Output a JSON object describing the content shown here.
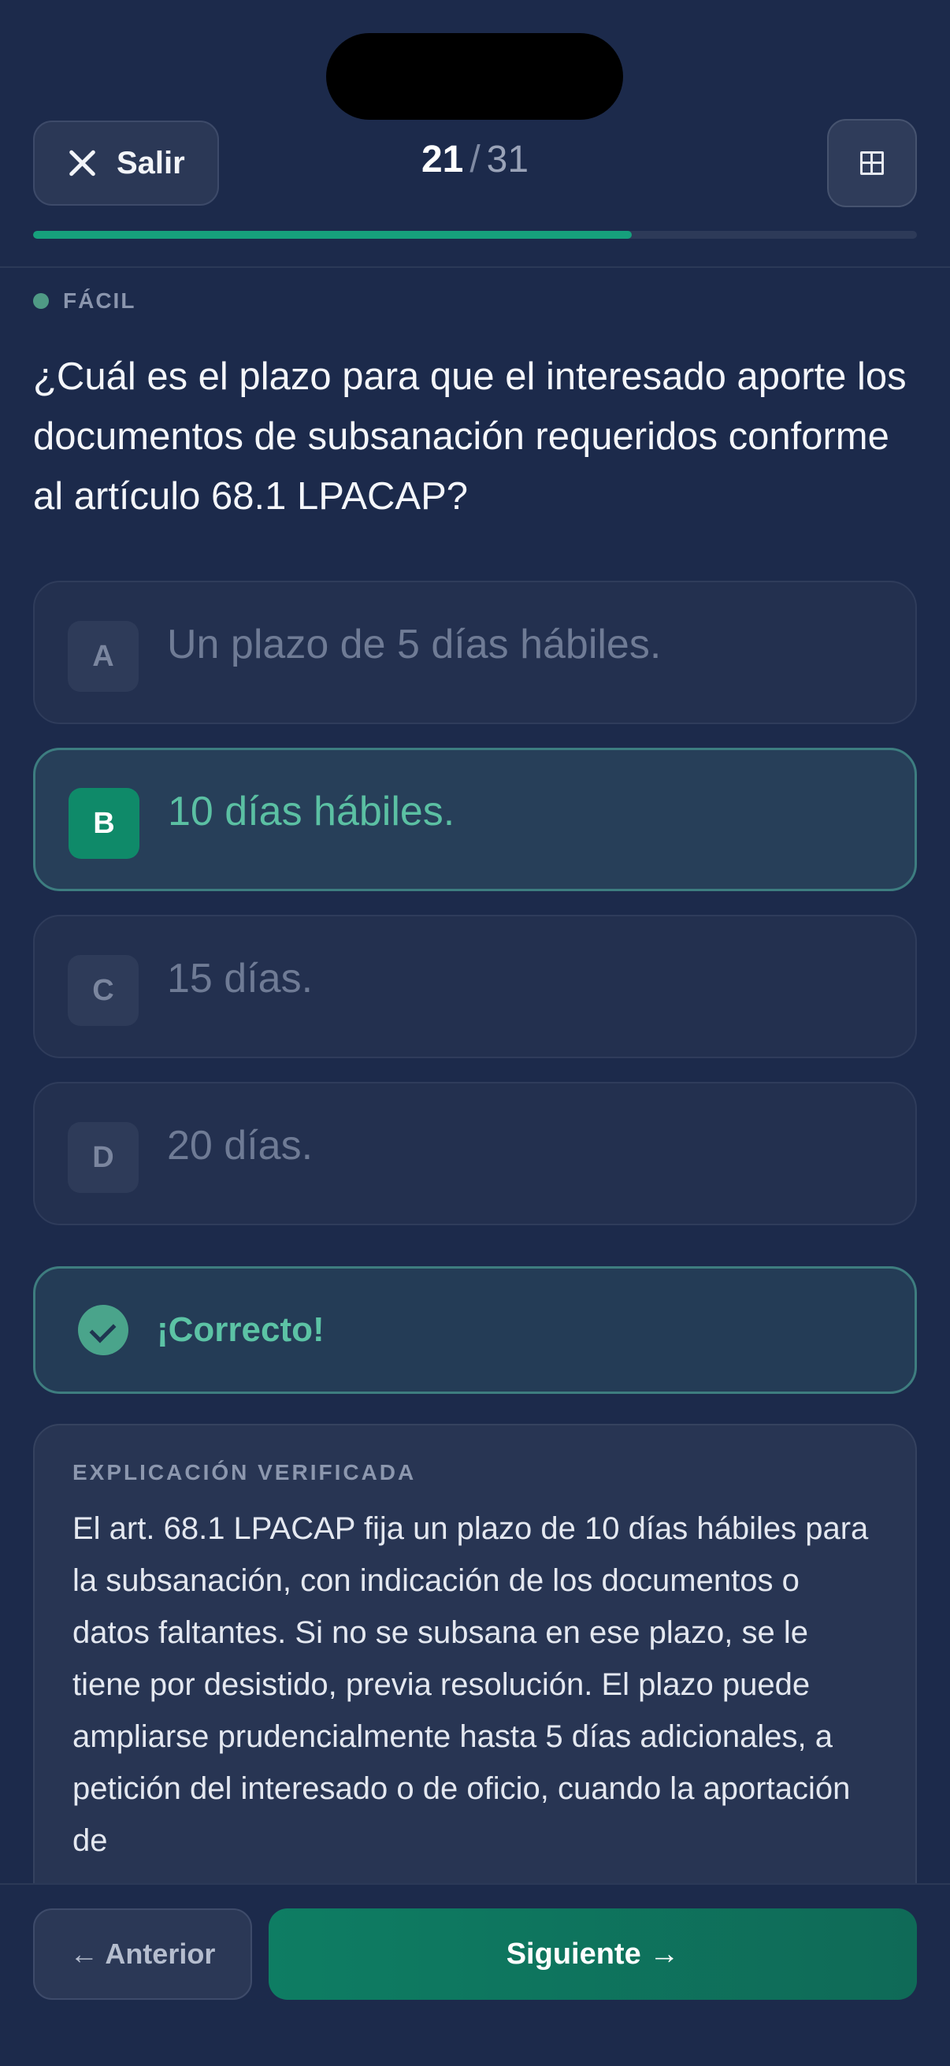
{
  "header": {
    "exit_label": "Salir",
    "counter_current": "21",
    "counter_separator": "/",
    "counter_total": "31",
    "progress_fraction": 0.677
  },
  "question": {
    "difficulty": "FÁCIL",
    "text": "¿Cuál es el plazo para que el interesado aporte los documentos de subsanación requeridos conforme al artículo 68.1 LPACAP?"
  },
  "options": [
    {
      "letter": "A",
      "text": "Un plazo de 5 días hábiles.",
      "state": "default"
    },
    {
      "letter": "B",
      "text": "10 días hábiles.",
      "state": "correct"
    },
    {
      "letter": "C",
      "text": "15 días.",
      "state": "default"
    },
    {
      "letter": "D",
      "text": "20 días.",
      "state": "default"
    }
  ],
  "feedback": {
    "text": "¡Correcto!"
  },
  "explanation": {
    "title": "EXPLICACIÓN VERIFICADA",
    "body": "El art. 68.1 LPACAP fija un plazo de 10 días hábiles para la subsanación, con indicación de los documentos o datos faltantes. Si no se subsana en ese plazo, se le tiene por desistido, previa resolución. El plazo puede ampliarse prudencialmente hasta 5 días adicionales, a petición del interesado o de oficio, cuando la aportación de"
  },
  "footer": {
    "prev_label": "← Anterior",
    "next_label": "Siguiente →"
  },
  "colors": {
    "accent": "#16a07c",
    "correct_text": "#5bc0a3",
    "background": "#1c2a4b"
  }
}
